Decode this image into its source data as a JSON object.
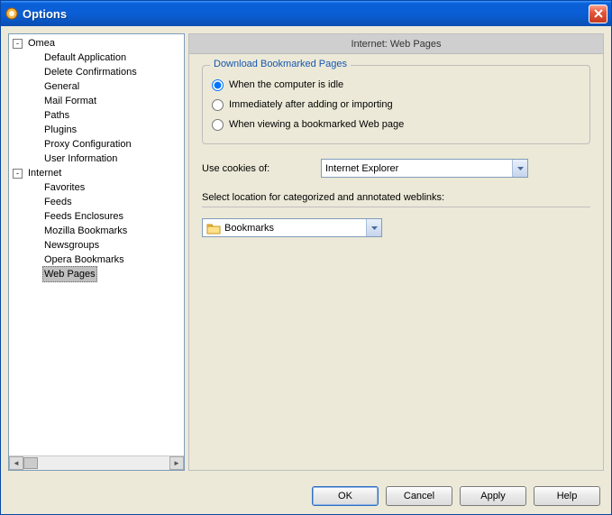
{
  "window": {
    "title": "Options"
  },
  "tree": {
    "root1": {
      "label": "Omea",
      "children": [
        "Default Application",
        "Delete Confirmations",
        "General",
        "Mail Format",
        "Paths",
        "Plugins",
        "Proxy Configuration",
        "User Information"
      ]
    },
    "root2": {
      "label": "Internet",
      "children": [
        "Favorites",
        "Feeds",
        "Feeds Enclosures",
        "Mozilla Bookmarks",
        "Newsgroups",
        "Opera Bookmarks",
        "Web Pages"
      ],
      "selected_index": 6
    }
  },
  "panel": {
    "header": "Internet: Web Pages",
    "group_legend": "Download Bookmarked Pages",
    "radio_idle": "When the computer is idle",
    "radio_import": "Immediately after adding or importing",
    "radio_view": "When viewing a bookmarked Web page",
    "radio_selected": 0,
    "cookies_label": "Use cookies of:",
    "cookies_value": "Internet Explorer",
    "location_label": "Select location for categorized and annotated weblinks:",
    "location_value": "Bookmarks"
  },
  "buttons": {
    "ok": "OK",
    "cancel": "Cancel",
    "apply": "Apply",
    "help": "Help"
  }
}
